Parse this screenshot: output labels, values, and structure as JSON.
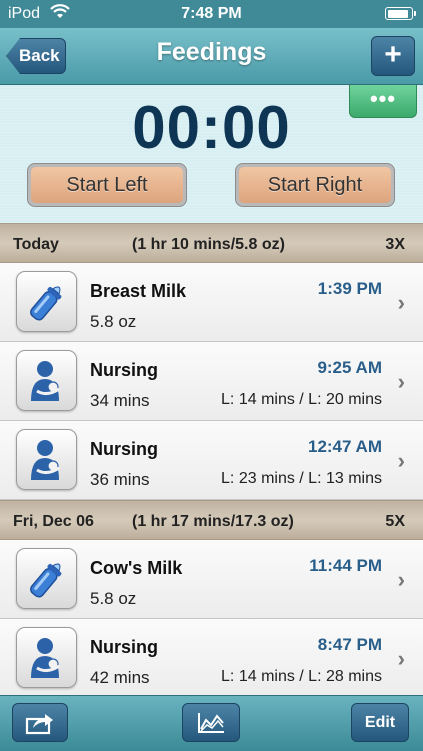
{
  "status_bar": {
    "carrier": "iPod",
    "time": "7:48 PM",
    "battery_level": 0.9
  },
  "nav": {
    "back_label": "Back",
    "title": "Feedings",
    "add_label": "+"
  },
  "timer": {
    "more_label": "•••",
    "display": "00:00",
    "start_left_label": "Start Left",
    "start_right_label": "Start Right"
  },
  "sections": [
    {
      "day": "Today",
      "summary": "(1 hr 10 mins/5.8 oz)",
      "count": "3X",
      "rows": [
        {
          "icon": "bottle-icon",
          "title": "Breast Milk",
          "amount": "5.8 oz",
          "time": "1:39 PM",
          "detail": ""
        },
        {
          "icon": "nursing-icon",
          "title": "Nursing",
          "amount": "34 mins",
          "time": "9:25 AM",
          "detail": "L: 14 mins / L: 20 mins"
        },
        {
          "icon": "nursing-icon",
          "title": "Nursing",
          "amount": "36 mins",
          "time": "12:47 AM",
          "detail": "L: 23 mins / L: 13 mins"
        }
      ]
    },
    {
      "day": "Fri, Dec 06",
      "summary": "(1 hr 17 mins/17.3 oz)",
      "count": "5X",
      "rows": [
        {
          "icon": "bottle-icon",
          "title": "Cow's Milk",
          "amount": "5.8 oz",
          "time": "11:44 PM",
          "detail": ""
        },
        {
          "icon": "nursing-icon",
          "title": "Nursing",
          "amount": "42 mins",
          "time": "8:47 PM",
          "detail": "L: 14 mins / L: 28 mins"
        }
      ]
    }
  ],
  "toolbar": {
    "edit_label": "Edit"
  },
  "colors": {
    "nav": "#4a9aa8",
    "button": "#24577c",
    "timer_text": "#0e3554",
    "time_text": "#2a5e8a",
    "more_button": "#3ba96b"
  }
}
